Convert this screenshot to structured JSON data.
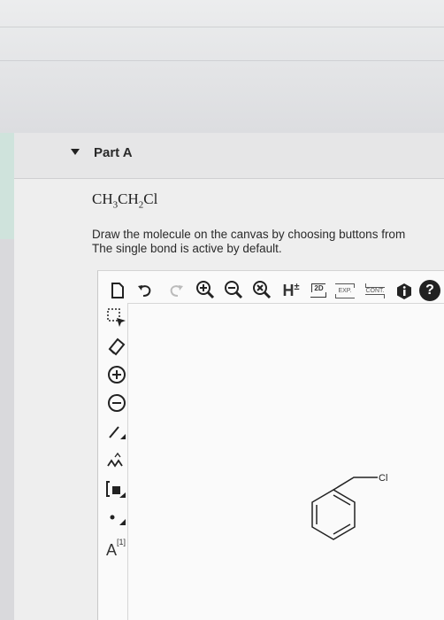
{
  "part": {
    "title": "Part A",
    "formula": {
      "a": "CH",
      "a_sub": "3",
      "b": "CH",
      "b_sub": "2",
      "c": "Cl"
    },
    "instruction_line1": "Draw the molecule on the canvas by choosing buttons from",
    "instruction_line2": "The single bond is active by default."
  },
  "toolbar": {
    "h_label": "H",
    "h_sup": "±",
    "twod_label": "2D",
    "exp_label": "EXP.",
    "cont_label": "CONT.",
    "help_label": "?"
  },
  "side_tools": {
    "atom_label": "A",
    "atom_sup": "[1]"
  },
  "canvas": {
    "atom_label": "Cl"
  },
  "colors": {
    "accent_green": "#cfe3dc",
    "icon_dark": "#222222"
  }
}
